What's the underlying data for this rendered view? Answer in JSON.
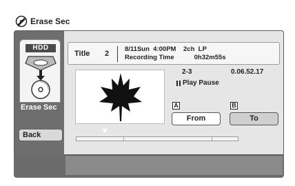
{
  "window": {
    "title": "Erase Sec",
    "icon": "disc-edit-icon"
  },
  "sidebar": {
    "media_tab": {
      "label": "HDD",
      "icon": "hdd-disc-icon"
    },
    "current_function": "Erase Sec",
    "back_label": "Back"
  },
  "info": {
    "title_label": "Title",
    "title_number": "2",
    "date_line": "8/11Sun  4:00PM    2ch  LP",
    "recording_line": "Recording Time           0h32m55s"
  },
  "thumbnail": {
    "icon": "maple-leaf-icon"
  },
  "playback": {
    "chapter": "2-3",
    "time": "0.06.52.17",
    "status": "Play Pause",
    "status_icon": "pause-icon"
  },
  "markers": {
    "a": "A",
    "b": "B"
  },
  "buttons": {
    "from": "From",
    "to": "To"
  },
  "progress": {
    "position_fraction": 0.18
  },
  "colors": {
    "frame": "#6b6b6b",
    "panel": "#e6e6e6",
    "selected_button": "#ffffff",
    "unselected_button": "#cfcfcf"
  }
}
